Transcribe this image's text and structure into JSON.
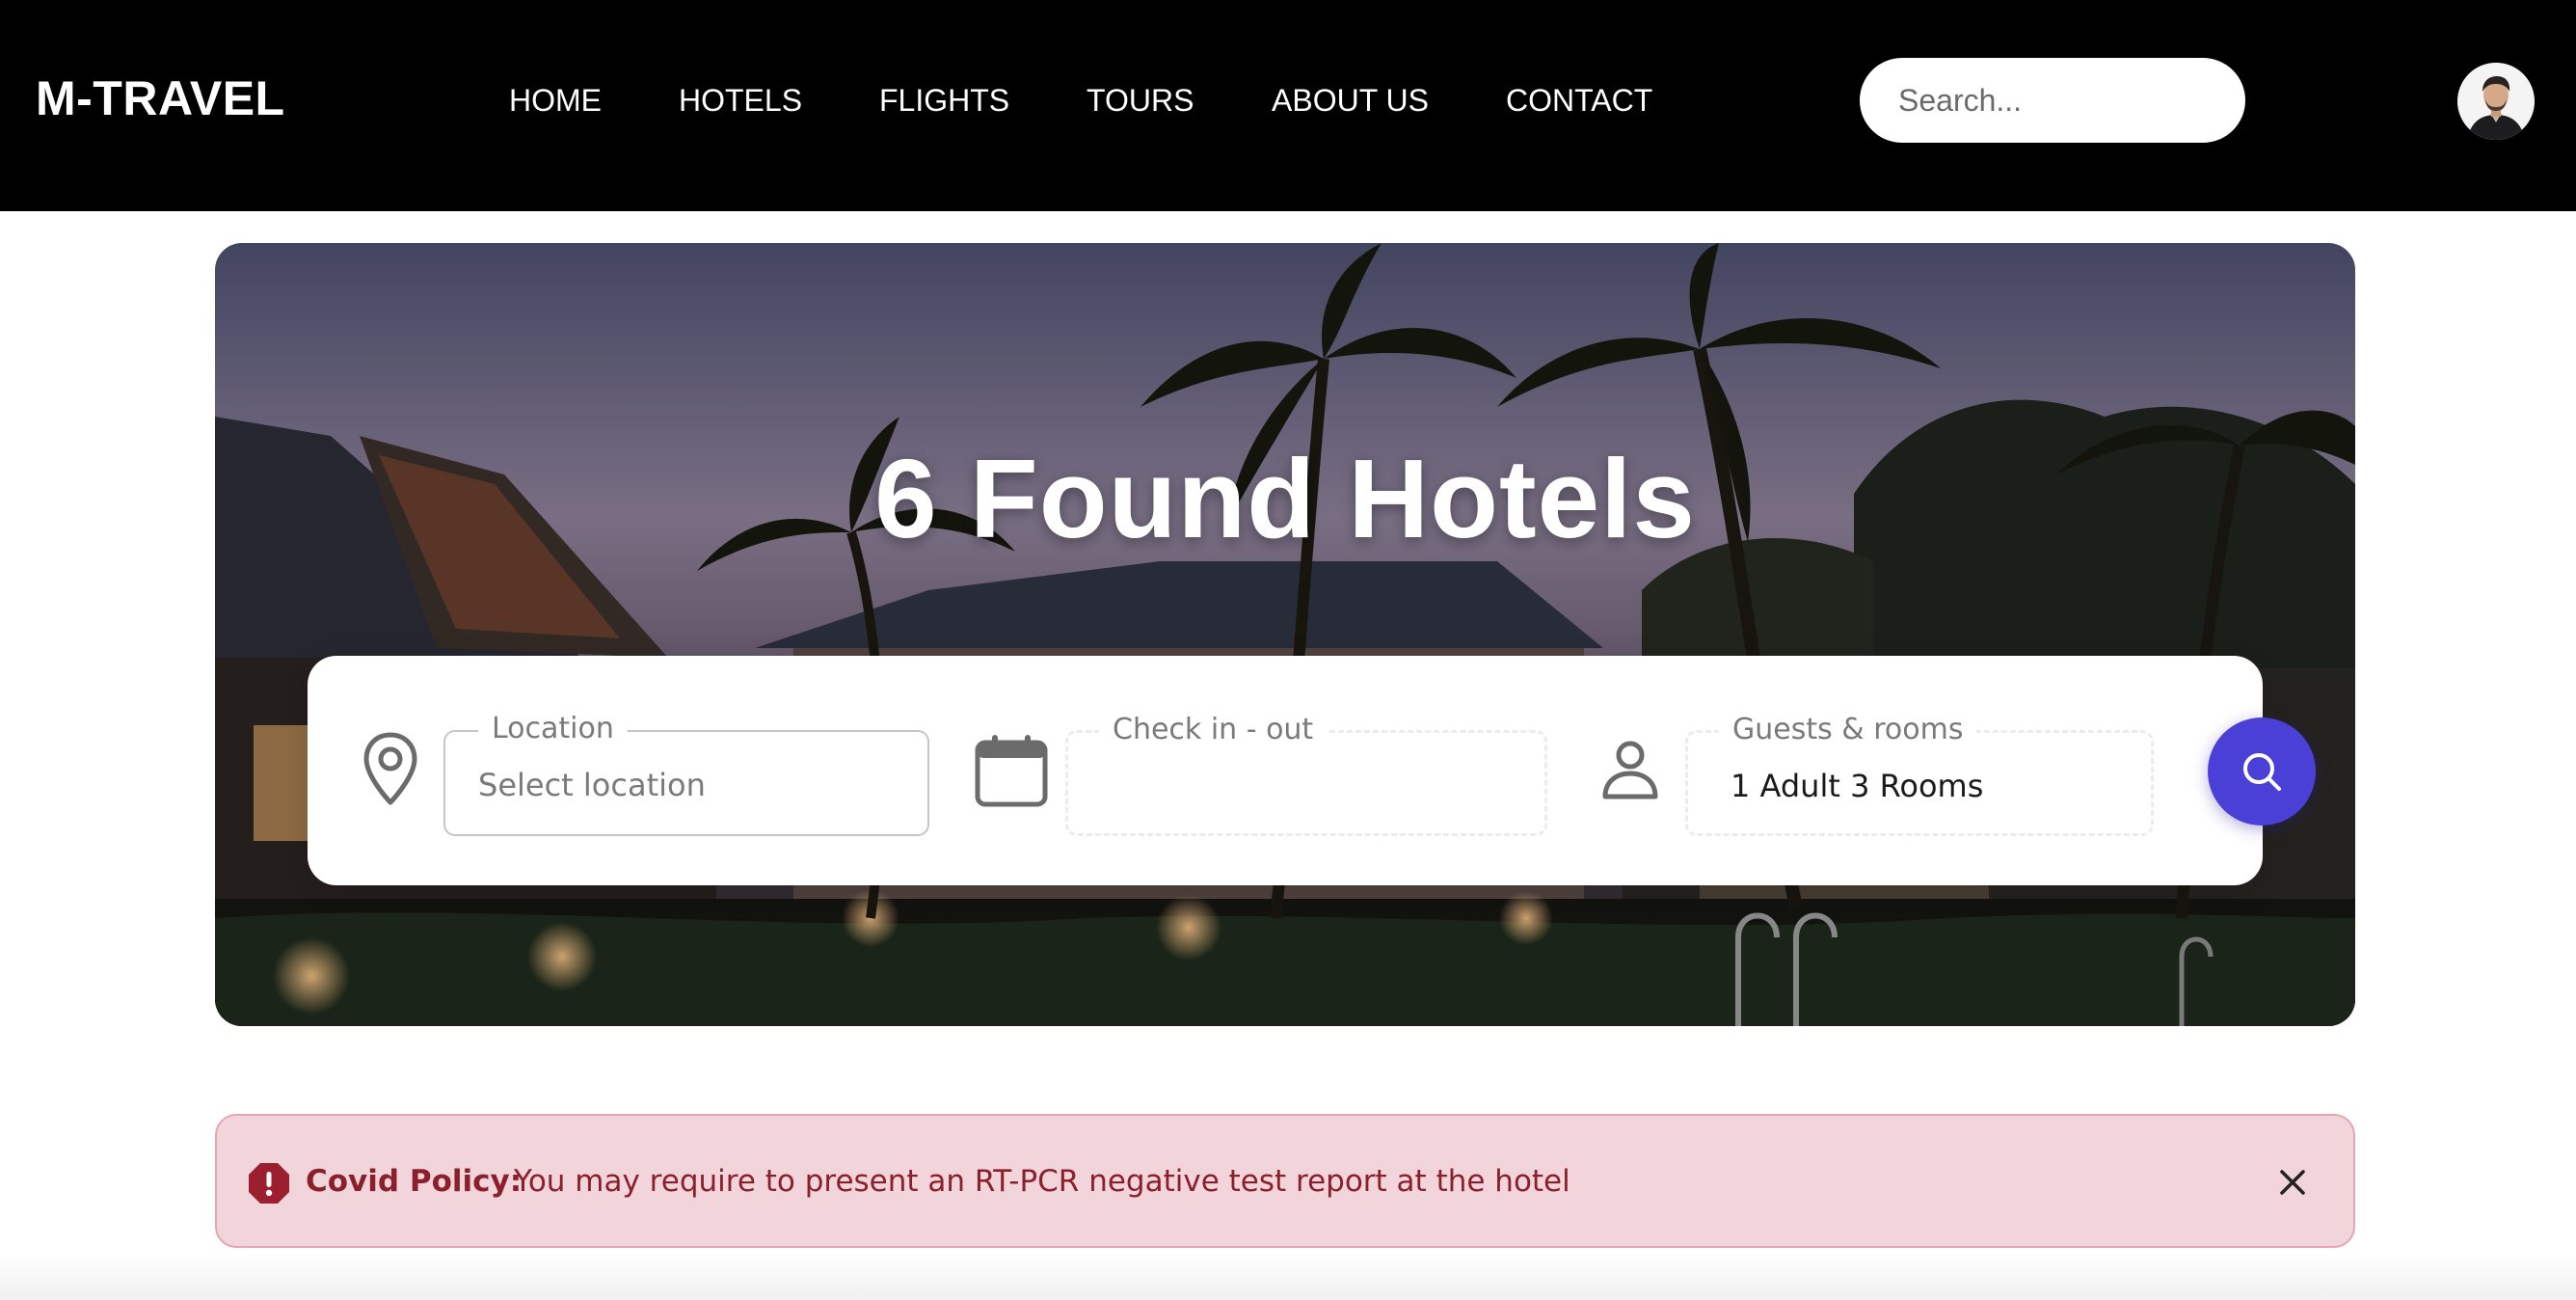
{
  "brand": {
    "name": "M-TRAVEL"
  },
  "nav": {
    "items": [
      {
        "label": "HOME"
      },
      {
        "label": "HOTELS"
      },
      {
        "label": "FLIGHTS"
      },
      {
        "label": "TOURS"
      },
      {
        "label": "ABOUT US"
      },
      {
        "label": "CONTACT"
      }
    ],
    "search": {
      "placeholder": "Search...",
      "value": ""
    }
  },
  "hero": {
    "title": "6 Found Hotels"
  },
  "booking": {
    "location": {
      "legend": "Location",
      "placeholder": "Select location",
      "value": "",
      "icon": "map-pin-icon"
    },
    "dates": {
      "legend": "Check in - out",
      "value": "",
      "icon": "calendar-icon"
    },
    "guests": {
      "legend": "Guests & rooms",
      "value": "1 Adult 3 Rooms",
      "icon": "person-icon"
    },
    "search_icon": "search-icon"
  },
  "alert": {
    "label": "Covid Policy:",
    "text": "You may require to present an RT-PCR negative test report at the hotel",
    "icon": "exclamation-icon",
    "close_icon": "close-icon"
  },
  "colors": {
    "navbar": "#000000",
    "accent": "#4a3fd6",
    "alert_bg": "#f2d5da",
    "alert_border": "#e6a6b0",
    "alert_text": "#8c1f2c"
  }
}
